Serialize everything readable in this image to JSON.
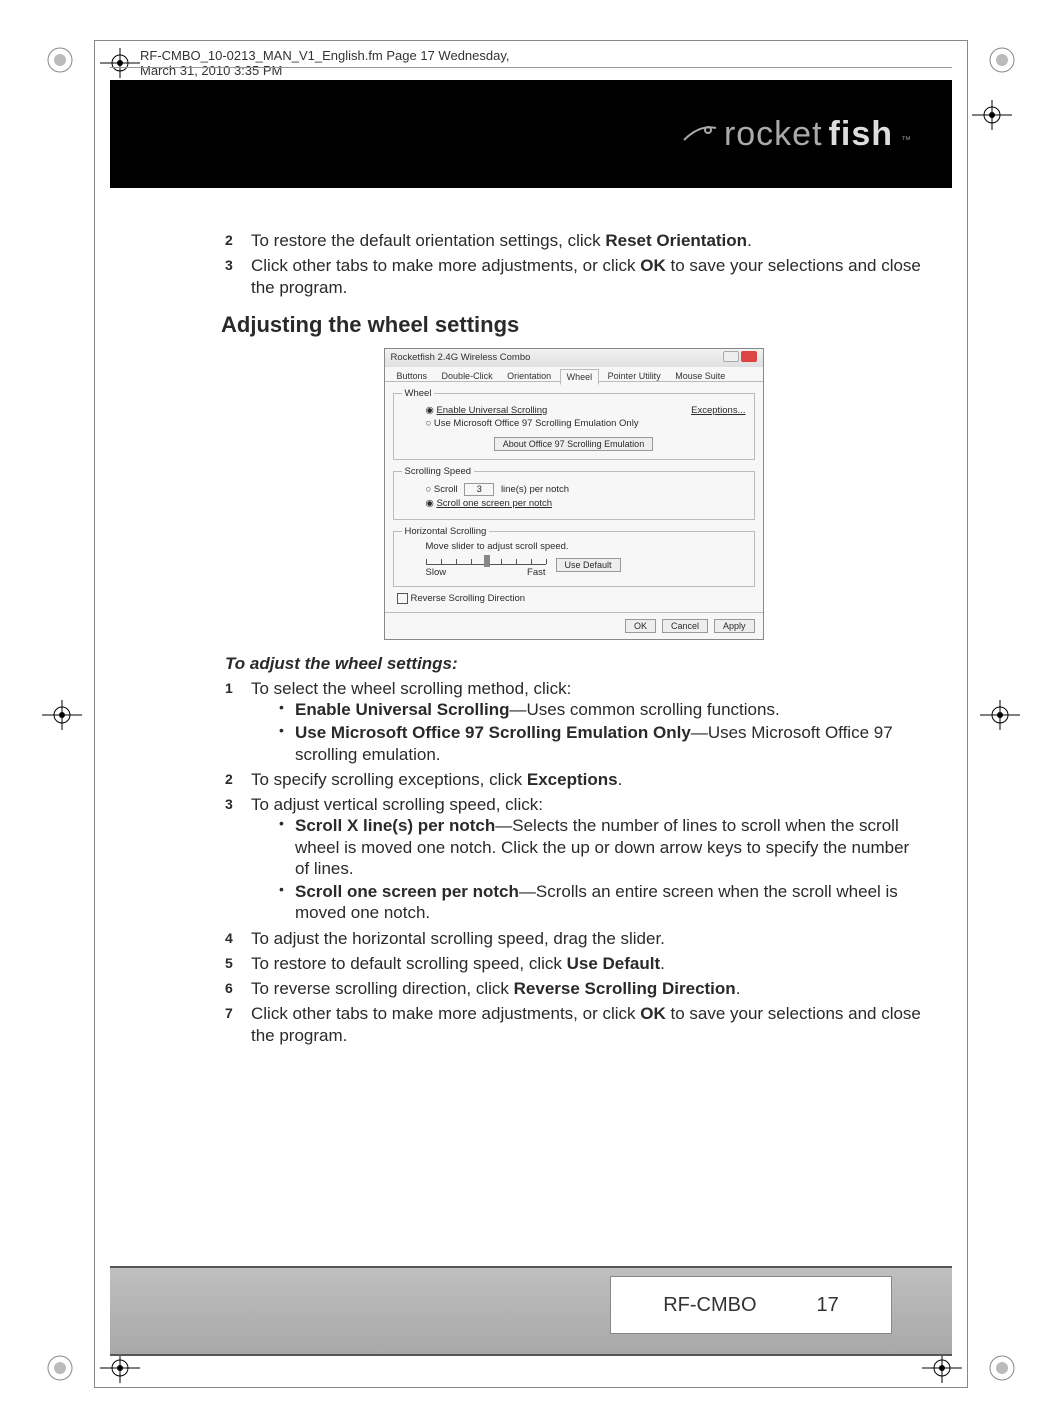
{
  "header_meta": "RF-CMBO_10-0213_MAN_V1_English.fm  Page 17  Wednesday, March 31, 2010  3:35 PM",
  "brand": {
    "prefix": "rocket",
    "suffix": "fish",
    "tm": "™"
  },
  "pre_steps": [
    {
      "num": "2",
      "text_a": "To restore the default orientation settings, click ",
      "bold": "Reset Orientation",
      "text_b": "."
    },
    {
      "num": "3",
      "text_a": "Click other tabs to make more adjustments, or click ",
      "bold": "OK",
      "text_b": " to save your selections and close the program."
    }
  ],
  "section_title": "Adjusting the wheel settings",
  "figure": {
    "title": "Rocketfish 2.4G Wireless Combo",
    "tabs": [
      "Buttons",
      "Double-Click",
      "Orientation",
      "Wheel",
      "Pointer Utility",
      "Mouse Suite"
    ],
    "active_tab": "Wheel",
    "wheel": {
      "legend": "Wheel",
      "opt1": "Enable Universal Scrolling",
      "exceptions": "Exceptions...",
      "opt2": "Use Microsoft Office 97 Scrolling Emulation Only",
      "about_btn": "About Office 97 Scrolling Emulation"
    },
    "speed": {
      "legend": "Scrolling Speed",
      "opt1": "Scroll",
      "lines_value": "3",
      "lines_suffix": "line(s) per notch",
      "opt2": "Scroll one screen per notch"
    },
    "horiz": {
      "legend": "Horizontal Scrolling",
      "hint": "Move slider to adjust scroll speed.",
      "slow": "Slow",
      "fast": "Fast",
      "default_btn": "Use Default"
    },
    "reverse": "Reverse Scrolling Direction",
    "buttons": {
      "ok": "OK",
      "cancel": "Cancel",
      "apply": "Apply"
    }
  },
  "sub_head": "To adjust the wheel settings:",
  "steps": {
    "s1": {
      "num": "1",
      "text": "To select the wheel scrolling method, click:"
    },
    "s1_b1": {
      "bold": "Enable Universal Scrolling",
      "rest": "—Uses common scrolling functions."
    },
    "s1_b2": {
      "bold": "Use Microsoft Office 97 Scrolling Emulation Only",
      "rest": "—Uses Microsoft Office 97 scrolling emulation."
    },
    "s2": {
      "num": "2",
      "text_a": "To specify scrolling exceptions, click ",
      "bold": "Exceptions",
      "text_b": "."
    },
    "s3": {
      "num": "3",
      "text": "To adjust vertical scrolling speed, click:"
    },
    "s3_b1": {
      "bold": "Scroll X line(s) per notch",
      "rest": "—Selects the number of lines to scroll when the scroll wheel is moved one notch. Click the up or down arrow keys to specify the number of lines."
    },
    "s3_b2": {
      "bold": "Scroll one screen per notch",
      "rest": "—Scrolls an entire screen when the scroll wheel is moved one notch."
    },
    "s4": {
      "num": "4",
      "text": "To adjust the horizontal scrolling speed, drag the slider."
    },
    "s5": {
      "num": "5",
      "text_a": "To restore to default scrolling speed, click ",
      "bold": "Use Default",
      "text_b": "."
    },
    "s6": {
      "num": "6",
      "text_a": "To reverse scrolling direction, click ",
      "bold": "Reverse Scrolling Direction",
      "text_b": "."
    },
    "s7": {
      "num": "7",
      "text_a": "Click other tabs to make more adjustments, or click ",
      "bold": "OK",
      "text_b": " to save your selections and close the program."
    }
  },
  "footer": {
    "model": "RF-CMBO",
    "page": "17"
  }
}
